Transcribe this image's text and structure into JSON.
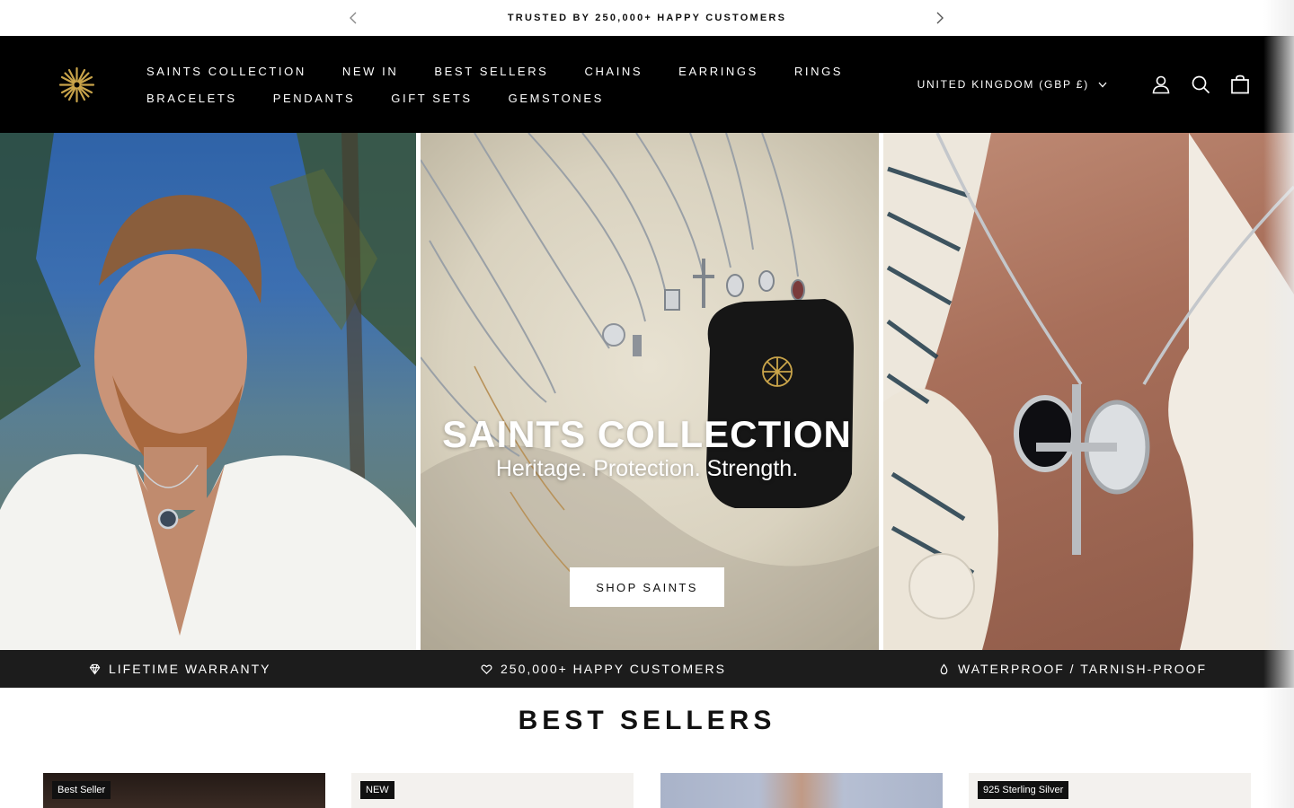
{
  "announcement": {
    "text": "TRUSTED BY 250,000+ HAPPY CUSTOMERS",
    "prev_icon": "chevron-left-icon",
    "next_icon": "chevron-right-icon"
  },
  "header": {
    "logo_icon": "brand-star-logo-icon",
    "nav_row1": [
      "SAINTS COLLECTION",
      "NEW IN",
      "BEST SELLERS",
      "CHAINS",
      "EARRINGS",
      "RINGS"
    ],
    "nav_row2": [
      "BRACELETS",
      "PENDANTS",
      "GIFT SETS",
      "GEMSTONES"
    ],
    "country": "UNITED KINGDOM (GBP £)",
    "icons": [
      "account-icon",
      "search-icon",
      "cart-icon"
    ]
  },
  "hero": {
    "title": "SAINTS COLLECTION",
    "subtitle": "Heritage. Protection. Strength.",
    "cta": "SHOP SAINTS"
  },
  "usp": [
    {
      "icon": "diamond-icon",
      "label": "LIFETIME WARRANTY"
    },
    {
      "icon": "heart-icon",
      "label": "250,000+ HAPPY CUSTOMERS"
    },
    {
      "icon": "droplet-icon",
      "label": "WATERPROOF / TARNISH-PROOF"
    }
  ],
  "best_sellers": {
    "title": "BEST SELLERS",
    "cards": [
      {
        "badge": "Best Seller"
      },
      {
        "badge": "NEW"
      },
      {
        "badge": ""
      },
      {
        "badge": "925 Sterling Silver"
      }
    ]
  },
  "colors": {
    "header_bg": "#000000",
    "usp_bg": "#1c1c1c",
    "accent_gold": "#c9a44a"
  }
}
